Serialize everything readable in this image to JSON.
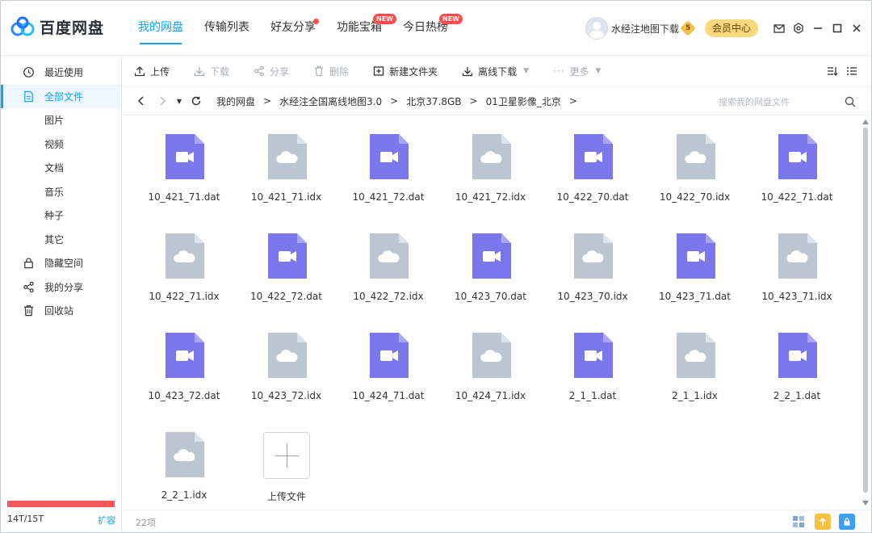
{
  "app": {
    "name": "百度网盘"
  },
  "nav": {
    "tabs": [
      {
        "label": "我的网盘",
        "active": true
      },
      {
        "label": "传输列表"
      },
      {
        "label": "好友分享",
        "dot": true
      },
      {
        "label": "功能宝箱",
        "badge": "NEW"
      },
      {
        "label": "今日热榜",
        "badge": "NEW"
      }
    ]
  },
  "user": {
    "name": "水经注地图下载",
    "vip_level": "5",
    "vip_button": "会员中心"
  },
  "sidebar": {
    "items": [
      {
        "label": "最近使用",
        "icon": "clock-icon"
      },
      {
        "label": "全部文件",
        "icon": "file-icon",
        "active": true
      },
      {
        "label": "图片",
        "sub": true
      },
      {
        "label": "视频",
        "sub": true
      },
      {
        "label": "文档",
        "sub": true
      },
      {
        "label": "音乐",
        "sub": true
      },
      {
        "label": "种子",
        "sub": true
      },
      {
        "label": "其它",
        "sub": true
      },
      {
        "label": "隐藏空间",
        "icon": "lock-icon"
      },
      {
        "label": "我的分享",
        "icon": "share-icon"
      },
      {
        "label": "回收站",
        "icon": "trash-icon"
      }
    ],
    "quota": {
      "text": "14T/15T",
      "used_fraction": 0.933,
      "expand_label": "扩容"
    }
  },
  "toolbar": {
    "upload": "上传",
    "download": "下载",
    "share": "分享",
    "delete": "删除",
    "new_folder": "新建文件夹",
    "offline_download": "离线下载",
    "more": "更多"
  },
  "breadcrumb": {
    "items": [
      "我的网盘",
      "水经注全国离线地图3.0",
      "北京37.8GB",
      "01卫星影像_北京"
    ],
    "search_placeholder": "搜索我的网盘文件"
  },
  "files": [
    {
      "name": "10_421_71.dat",
      "type": "video"
    },
    {
      "name": "10_421_71.idx",
      "type": "cloud"
    },
    {
      "name": "10_421_72.dat",
      "type": "video"
    },
    {
      "name": "10_421_72.idx",
      "type": "cloud"
    },
    {
      "name": "10_422_70.dat",
      "type": "video"
    },
    {
      "name": "10_422_70.idx",
      "type": "cloud"
    },
    {
      "name": "10_422_71.dat",
      "type": "video"
    },
    {
      "name": "10_422_71.idx",
      "type": "cloud"
    },
    {
      "name": "10_422_72.dat",
      "type": "video"
    },
    {
      "name": "10_422_72.idx",
      "type": "cloud"
    },
    {
      "name": "10_423_70.dat",
      "type": "video"
    },
    {
      "name": "10_423_70.idx",
      "type": "cloud"
    },
    {
      "name": "10_423_71.dat",
      "type": "video"
    },
    {
      "name": "10_423_71.idx",
      "type": "cloud"
    },
    {
      "name": "10_423_72.dat",
      "type": "video"
    },
    {
      "name": "10_423_72.idx",
      "type": "cloud"
    },
    {
      "name": "10_424_71.dat",
      "type": "video"
    },
    {
      "name": "10_424_71.idx",
      "type": "cloud"
    },
    {
      "name": "2_1_1.dat",
      "type": "video"
    },
    {
      "name": "2_1_1.idx",
      "type": "cloud"
    },
    {
      "name": "2_2_1.dat",
      "type": "video"
    },
    {
      "name": "2_2_1.idx",
      "type": "cloud"
    }
  ],
  "upload_tile": {
    "label": "上传文件"
  },
  "status": {
    "count": "22项"
  },
  "colors": {
    "accent": "#06a7ff",
    "video_file": "#7b78ee",
    "cloud_file": "#bcc6d2",
    "quota_bar": "#f5585a",
    "vip_gold": "#f9d87e"
  }
}
